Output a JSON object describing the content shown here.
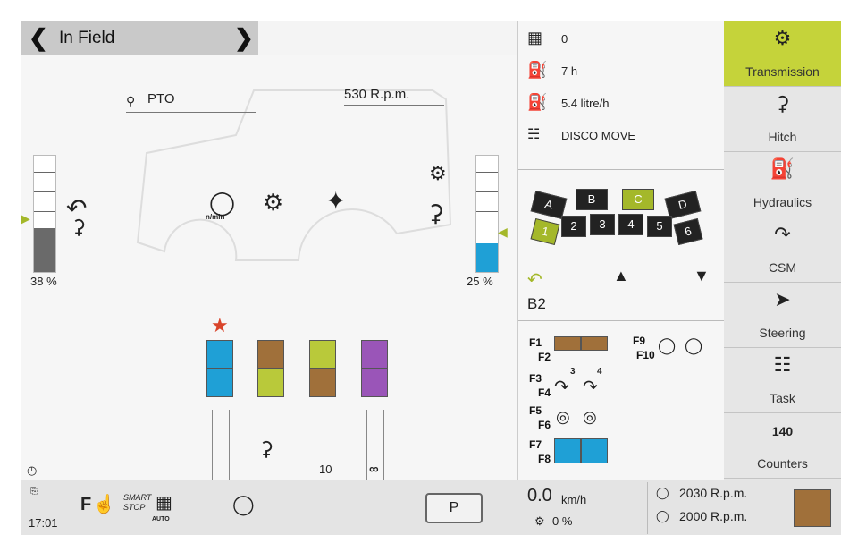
{
  "header": {
    "title": "In Field"
  },
  "main": {
    "pto_label": "PTO",
    "rpm": "530 R.p.m.",
    "left_gauge": {
      "label": "38 %",
      "level": 0.38
    },
    "right_gauge": {
      "label": "25 %",
      "level": 0.25
    },
    "bottom_label_10": "10",
    "bottom_label_inf": "∞"
  },
  "info": {
    "area_value": "0",
    "hours_value": "7 h",
    "fuel_rate": "5.4 litre/h",
    "implement_name": "DISCO MOVE"
  },
  "gears": {
    "ranges": [
      "A",
      "B",
      "C",
      "D"
    ],
    "active_range": "C",
    "steps": [
      "1",
      "2",
      "3",
      "4",
      "5",
      "6"
    ],
    "active_step": "1",
    "current": "B2"
  },
  "functions": {
    "f1": "F1",
    "f2": "F2",
    "f3": "F3",
    "f4": "F4",
    "f5": "F5",
    "f6": "F6",
    "f7": "F7",
    "f8": "F8",
    "f9": "F9",
    "f10": "F10",
    "csm_3": "3",
    "csm_4": "4"
  },
  "sidebar": {
    "items": [
      {
        "label": "Transmission",
        "icon": "gears-icon",
        "active": true
      },
      {
        "label": "Hitch",
        "icon": "hitch-icon",
        "active": false
      },
      {
        "label": "Hydraulics",
        "icon": "hydraulics-icon",
        "active": false
      },
      {
        "label": "CSM",
        "icon": "csm-icon",
        "active": false
      },
      {
        "label": "Steering",
        "icon": "steering-icon",
        "active": false
      },
      {
        "label": "Task",
        "icon": "clipboard-icon",
        "active": false
      },
      {
        "label": "Counters",
        "icon": "counter-icon",
        "active": false
      }
    ],
    "counter_digits": "140"
  },
  "bottom": {
    "clock": "17:01",
    "f_label": "F",
    "smart": "SMART",
    "stop": "STOP",
    "auto": "AUTO",
    "park": "P",
    "speed_value": "0.0",
    "speed_unit": "km/h",
    "slip": "0 %",
    "rpm_top": "2030 R.p.m.",
    "rpm_bottom": "2000 R.p.m."
  },
  "colors": {
    "accent": "#c5d33a",
    "blue": "#1fa0d6",
    "brown": "#a0703a",
    "lime": "#b9c93a",
    "purple": "#9a55b8"
  }
}
